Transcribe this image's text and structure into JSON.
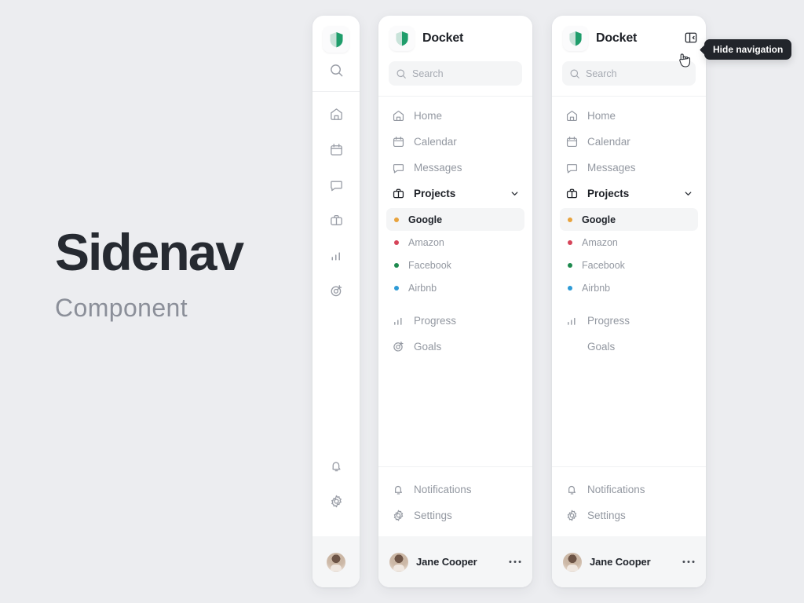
{
  "hero": {
    "title": "Sidenav",
    "subtitle": "Component"
  },
  "colors": {
    "background": "#ecedf0",
    "card": "#ffffff",
    "text_active": "#1d2026",
    "text_muted": "#9398a1",
    "brand_green_dark": "#1f9d6b",
    "brand_green_light": "#c9e3da",
    "selected_bg": "#f4f5f6",
    "footer_bg": "#f5f6f7",
    "tooltip_bg": "#22252b",
    "dot_google": "#e8a33d",
    "dot_amazon": "#d6455a",
    "dot_facebook": "#1d8a4e",
    "dot_airbnb": "#2e9bd6"
  },
  "rail": {
    "logo_icon": "shield-icon",
    "top_items": [
      {
        "icon": "search-icon",
        "name": "search"
      }
    ],
    "items": [
      {
        "icon": "home-icon",
        "name": "home"
      },
      {
        "icon": "calendar-icon",
        "name": "calendar"
      },
      {
        "icon": "message-icon",
        "name": "messages"
      },
      {
        "icon": "briefcase-icon",
        "name": "projects"
      },
      {
        "icon": "bar-chart-icon",
        "name": "progress"
      },
      {
        "icon": "target-icon",
        "name": "goals"
      }
    ],
    "bottom_items": [
      {
        "icon": "bell-icon",
        "name": "notifications"
      },
      {
        "icon": "gear-icon",
        "name": "settings"
      }
    ],
    "footer_avatar": "avatar"
  },
  "panel": {
    "brand": {
      "logo_icon": "shield-icon",
      "name": "Docket"
    },
    "search": {
      "icon": "search-icon",
      "placeholder": "Search",
      "value": ""
    },
    "nav": [
      {
        "label": "Home",
        "icon": "home-icon",
        "active": false
      },
      {
        "label": "Calendar",
        "icon": "calendar-icon",
        "active": false
      },
      {
        "label": "Messages",
        "icon": "message-icon",
        "active": false
      },
      {
        "label": "Projects",
        "icon": "briefcase-icon",
        "active": true,
        "expanded": true,
        "chevron": "chevron-down-icon"
      }
    ],
    "projects": [
      {
        "label": "Google",
        "dot": "#e8a33d",
        "selected": true
      },
      {
        "label": "Amazon",
        "dot": "#d6455a",
        "selected": false
      },
      {
        "label": "Facebook",
        "dot": "#1d8a4e",
        "selected": false
      },
      {
        "label": "Airbnb",
        "dot": "#2e9bd6",
        "selected": false
      }
    ],
    "nav_secondary": [
      {
        "label": "Progress",
        "icon": "bar-chart-icon"
      },
      {
        "label": "Goals",
        "icon": "target-icon"
      }
    ],
    "nav_bottom": [
      {
        "label": "Notifications",
        "icon": "bell-icon"
      },
      {
        "label": "Settings",
        "icon": "gear-icon"
      }
    ],
    "user": {
      "name": "Jane Cooper",
      "avatar": "avatar",
      "more_icon": "more-horizontal-icon"
    }
  },
  "panel_b": {
    "collapse_button": {
      "icon": "collapse-sidebar-icon",
      "tooltip": "Hide navigation"
    },
    "goals_icon_hidden": true
  }
}
